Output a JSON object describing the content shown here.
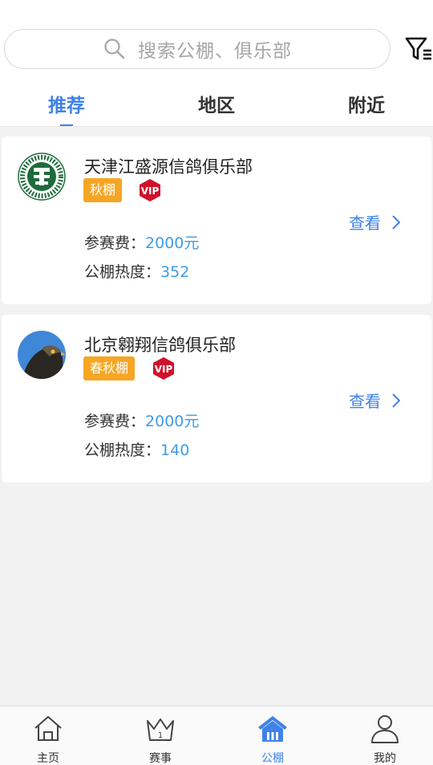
{
  "search": {
    "placeholder": "搜索公棚、俱乐部"
  },
  "tabs": [
    {
      "label": "推荐",
      "active": true
    },
    {
      "label": "地区",
      "active": false
    },
    {
      "label": "附近",
      "active": false
    }
  ],
  "clubs": [
    {
      "name": "天津江盛源信鸽俱乐部",
      "badge": "秋棚",
      "vip": "VIP",
      "view_label": "查看",
      "fee_label": "参赛费：",
      "fee_value": "2000元",
      "heat_label": "公棚热度：",
      "heat_value": "352"
    },
    {
      "name": "北京翱翔信鸽俱乐部",
      "badge": "春秋棚",
      "vip": "VIP",
      "view_label": "查看",
      "fee_label": "参赛费：",
      "fee_value": "2000元",
      "heat_label": "公棚热度：",
      "heat_value": "140"
    }
  ],
  "bottom_nav": [
    {
      "label": "主页",
      "icon": "home-outline-icon",
      "active": false
    },
    {
      "label": "赛事",
      "icon": "crown-icon",
      "active": false
    },
    {
      "label": "公棚",
      "icon": "loft-house-icon",
      "active": true
    },
    {
      "label": "我的",
      "icon": "person-icon",
      "active": false
    }
  ],
  "colors": {
    "accent": "#3f82e8",
    "badge": "#f5a623",
    "vip": "#d0112b",
    "value": "#3f9be8"
  }
}
